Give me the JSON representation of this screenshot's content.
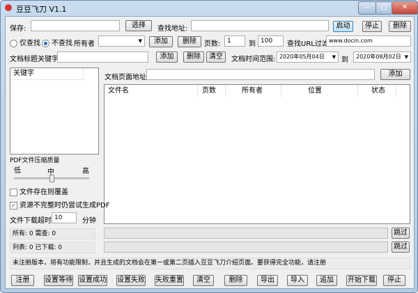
{
  "window": {
    "title": "豆豆飞刀 V1.1"
  },
  "row1": {
    "save_label": "保存:",
    "save_value": "",
    "choose": "选择",
    "find_label": "查找地址:",
    "find_value": "",
    "start": "启动",
    "stop": "停止",
    "delete": "删除"
  },
  "row2": {
    "radio_find_only": "仅查找",
    "radio_no_find": "不查找",
    "owner_label": "所有者",
    "owner_value": "",
    "add": "添加",
    "delete": "删除",
    "pages_label": "页数:",
    "page_from": "1",
    "to": "到",
    "page_to": "100",
    "url_filter_label": "查找URL过滤",
    "url_filter_value": "www.docin.com"
  },
  "row3": {
    "keyword_label": "文档标题关键字",
    "keyword_value": "",
    "add": "添加",
    "delete": "删除",
    "clear": "清空",
    "date_label": "文档时间范围:",
    "date_from": "2020年05月04日",
    "to": "到",
    "date_to": "2020年08月02日"
  },
  "keywords": {
    "header": "关键字"
  },
  "doc_url": {
    "label": "文档页面地址",
    "value": "",
    "add": "添加"
  },
  "table": {
    "columns": [
      "文件名",
      "页数",
      "所有者",
      "位置",
      "状态"
    ],
    "rows": []
  },
  "options": {
    "pdf_quality_label": "PDF文件压缩质量",
    "low": "低",
    "mid": "中",
    "high": "高",
    "quality_level": 0.5,
    "overwrite_label": "文件存在则覆盖",
    "overwrite_checked": false,
    "incomplete_label": "资源不完整时仍尝试生成PDF",
    "incomplete_checked": true,
    "timeout_label": "文件下载超时",
    "timeout_value": "10",
    "timeout_unit": "分钟"
  },
  "status": {
    "all": "所有: 0  需查: 0",
    "list": "列表: 0  已下载: 0",
    "skip1": "跳过",
    "skip2": "跳过"
  },
  "notice": "未注册版本，将有功能限制，并且生成的文档会在第一或第二页插入豆豆飞刀介绍页面。要获得完全功能，请注册",
  "bottom": [
    "注册",
    "设置等待",
    "设置成功",
    "设置失败",
    "失败重置",
    "清空",
    "删除",
    "导出",
    "导入",
    "追加",
    "开始下载",
    "停止"
  ]
}
